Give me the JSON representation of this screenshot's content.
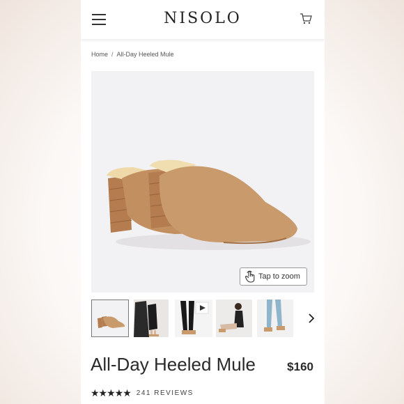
{
  "brand": "NISOLO",
  "header": {
    "menu_icon": "hamburger-icon",
    "cart_icon": "cart-icon"
  },
  "breadcrumb": {
    "items": [
      "Home",
      "All-Day Heeled Mule"
    ],
    "separator": "/"
  },
  "product": {
    "title": "All-Day Heeled Mule",
    "price": "$160",
    "rating_stars": 4.5,
    "stars_display": "★★★★★",
    "reviews": "241 REVIEWS",
    "zoom_label": "Tap to zoom"
  },
  "thumbnails": [
    {
      "name": "thumb-shoe-pair",
      "active": true
    },
    {
      "name": "thumb-model-dress"
    },
    {
      "name": "thumb-model-video",
      "video": true
    },
    {
      "name": "thumb-model-seated"
    },
    {
      "name": "thumb-model-jeans"
    }
  ],
  "colors": {
    "leather": "#c89a6c",
    "heel": "#b57d4f",
    "image_bg": "#f2f2f4",
    "text": "#2a2a2a"
  }
}
